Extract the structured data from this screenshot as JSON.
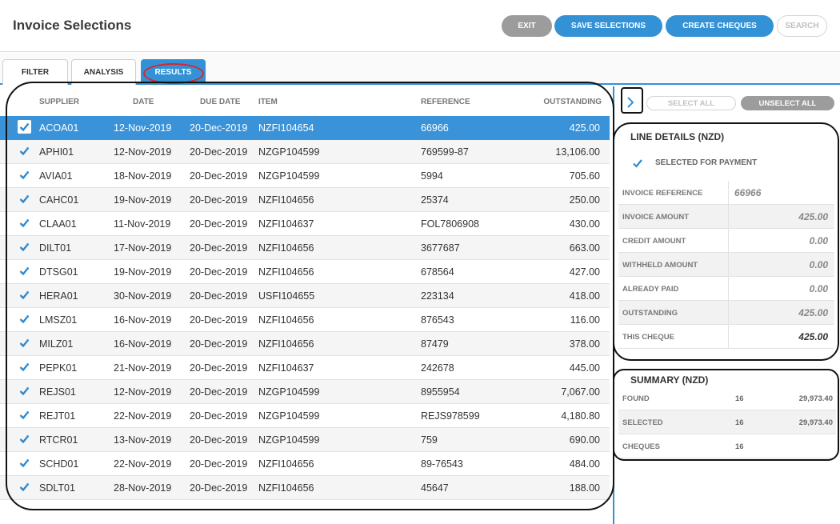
{
  "header": {
    "title": "Invoice Selections",
    "exit_label": "EXIT",
    "save_label": "SAVE SELECTIONS",
    "create_label": "CREATE CHEQUES",
    "search_label": "SEARCH"
  },
  "tabs": [
    {
      "label": "FILTER"
    },
    {
      "label": "ANALYSIS"
    },
    {
      "label": "RESULTS",
      "active": true
    }
  ],
  "table": {
    "headers": {
      "supplier": "SUPPLIER",
      "date": "DATE",
      "due_date": "DUE DATE",
      "item": "ITEM",
      "reference": "REFERENCE",
      "outstanding": "OUTSTANDING"
    },
    "rows": [
      {
        "supplier": "ACOA01",
        "date": "12-Nov-2019",
        "due": "20-Dec-2019",
        "item": "NZFI104654",
        "ref": "66966",
        "out": "425.00"
      },
      {
        "supplier": "APHI01",
        "date": "12-Nov-2019",
        "due": "20-Dec-2019",
        "item": "NZGP104599",
        "ref": "769599-87",
        "out": "13,106.00"
      },
      {
        "supplier": "AVIA01",
        "date": "18-Nov-2019",
        "due": "20-Dec-2019",
        "item": "NZGP104599",
        "ref": "5994",
        "out": "705.60"
      },
      {
        "supplier": "CAHC01",
        "date": "19-Nov-2019",
        "due": "20-Dec-2019",
        "item": "NZFI104656",
        "ref": "25374",
        "out": "250.00"
      },
      {
        "supplier": "CLAA01",
        "date": "11-Nov-2019",
        "due": "20-Dec-2019",
        "item": "NZFI104637",
        "ref": "FOL7806908",
        "out": "430.00"
      },
      {
        "supplier": "DILT01",
        "date": "17-Nov-2019",
        "due": "20-Dec-2019",
        "item": "NZFI104656",
        "ref": "3677687",
        "out": "663.00"
      },
      {
        "supplier": "DTSG01",
        "date": "19-Nov-2019",
        "due": "20-Dec-2019",
        "item": "NZFI104656",
        "ref": "678564",
        "out": "427.00"
      },
      {
        "supplier": "HERA01",
        "date": "30-Nov-2019",
        "due": "20-Dec-2019",
        "item": "USFI104655",
        "ref": "223134",
        "out": "418.00"
      },
      {
        "supplier": "LMSZ01",
        "date": "16-Nov-2019",
        "due": "20-Dec-2019",
        "item": "NZFI104656",
        "ref": "876543",
        "out": "116.00"
      },
      {
        "supplier": "MILZ01",
        "date": "16-Nov-2019",
        "due": "20-Dec-2019",
        "item": "NZFI104656",
        "ref": "87479",
        "out": "378.00"
      },
      {
        "supplier": "PEPK01",
        "date": "21-Nov-2019",
        "due": "20-Dec-2019",
        "item": "NZFI104637",
        "ref": "242678",
        "out": "445.00"
      },
      {
        "supplier": "REJS01",
        "date": "12-Nov-2019",
        "due": "20-Dec-2019",
        "item": "NZGP104599",
        "ref": "8955954",
        "out": "7,067.00"
      },
      {
        "supplier": "REJT01",
        "date": "22-Nov-2019",
        "due": "20-Dec-2019",
        "item": "NZGP104599",
        "ref": "REJS978599",
        "out": "4,180.80"
      },
      {
        "supplier": "RTCR01",
        "date": "13-Nov-2019",
        "due": "20-Dec-2019",
        "item": "NZGP104599",
        "ref": "759",
        "out": "690.00"
      },
      {
        "supplier": "SCHD01",
        "date": "22-Nov-2019",
        "due": "20-Dec-2019",
        "item": "NZFI104656",
        "ref": "89-76543",
        "out": "484.00"
      },
      {
        "supplier": "SDLT01",
        "date": "28-Nov-2019",
        "due": "20-Dec-2019",
        "item": "NZFI104656",
        "ref": "45647",
        "out": "188.00"
      }
    ]
  },
  "right": {
    "select_all": "SELECT ALL",
    "unselect_all": "UNSELECT ALL",
    "line_details": {
      "title": "LINE DETAILS (NZD)",
      "selected_label": "SELECTED FOR PAYMENT",
      "rows": [
        {
          "label": "INVOICE REFERENCE",
          "value": "66966"
        },
        {
          "label": "INVOICE AMOUNT",
          "value": "425.00"
        },
        {
          "label": "CREDIT AMOUNT",
          "value": "0.00"
        },
        {
          "label": "WITHHELD AMOUNT",
          "value": "0.00"
        },
        {
          "label": "ALREADY PAID",
          "value": "0.00"
        },
        {
          "label": "OUTSTANDING",
          "value": "425.00"
        },
        {
          "label": "THIS CHEQUE",
          "value": "425.00"
        }
      ]
    },
    "summary": {
      "title": "SUMMARY (NZD)",
      "rows": [
        {
          "label": "FOUND",
          "count": "16",
          "amount": "29,973.40"
        },
        {
          "label": "SELECTED",
          "count": "16",
          "amount": "29,973.40"
        },
        {
          "label": "CHEQUES",
          "count": "16",
          "amount": ""
        }
      ]
    }
  },
  "colors": {
    "accent": "#3392d6",
    "selected_row": "#3a93d8",
    "grey_button": "#9c9c9c",
    "annotation_oval": "#d8262c"
  }
}
